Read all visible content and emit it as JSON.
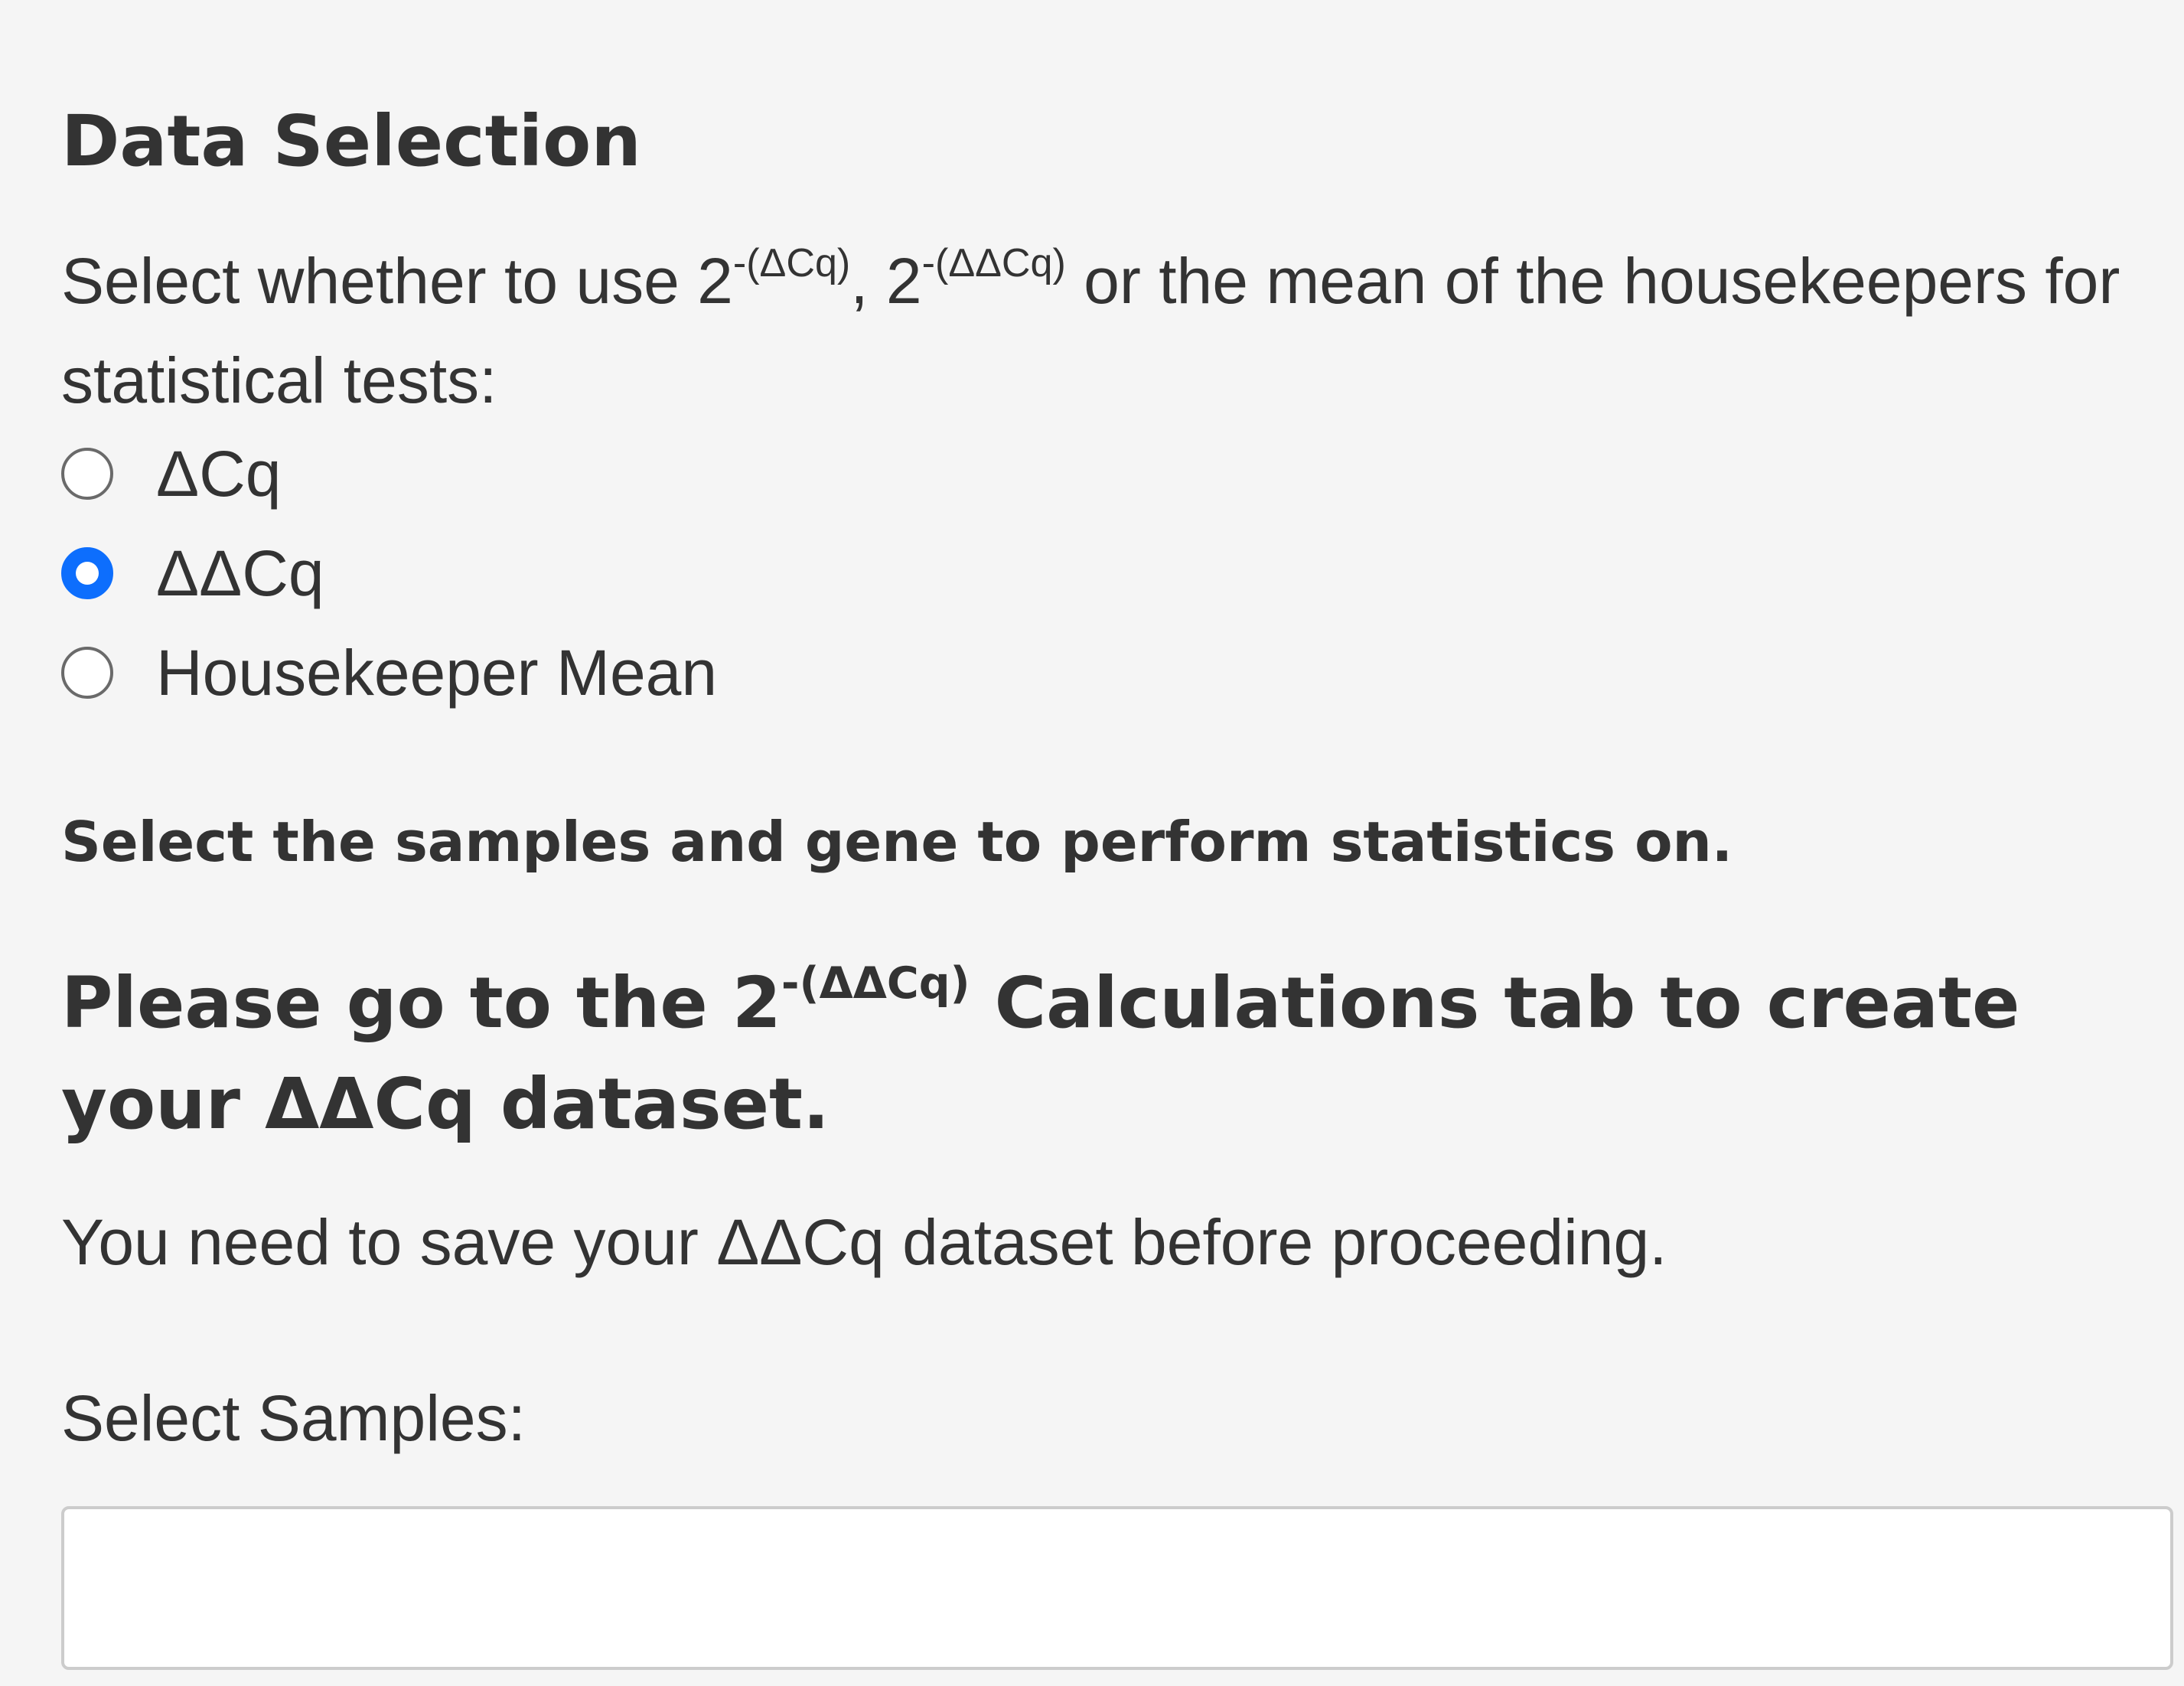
{
  "section": {
    "title": "Data Selection"
  },
  "intro": {
    "text_1": "Select whether to use 2",
    "sup_1": "-(ΔCq)",
    "text_2": ", 2",
    "sup_2": "-(ΔΔCq)",
    "text_3": " or the mean of the housekeepers for statistical tests:"
  },
  "data_type": {
    "options": [
      {
        "label": "ΔCq",
        "selected": false
      },
      {
        "label": "ΔΔCq",
        "selected": true
      },
      {
        "label": "Housekeeper Mean",
        "selected": false
      }
    ],
    "accent_color": "#0d6efd"
  },
  "instruction": "Select the samples and gene to perform statistics on.",
  "warning": {
    "text_1": "Please go to the 2",
    "sup": "-(ΔΔCq)",
    "text_2": " Calculations tab to create your ΔΔCq dataset."
  },
  "note": "You need to save your ΔΔCq dataset before proceeding.",
  "samples": {
    "label": "Select Samples:",
    "value": ""
  }
}
